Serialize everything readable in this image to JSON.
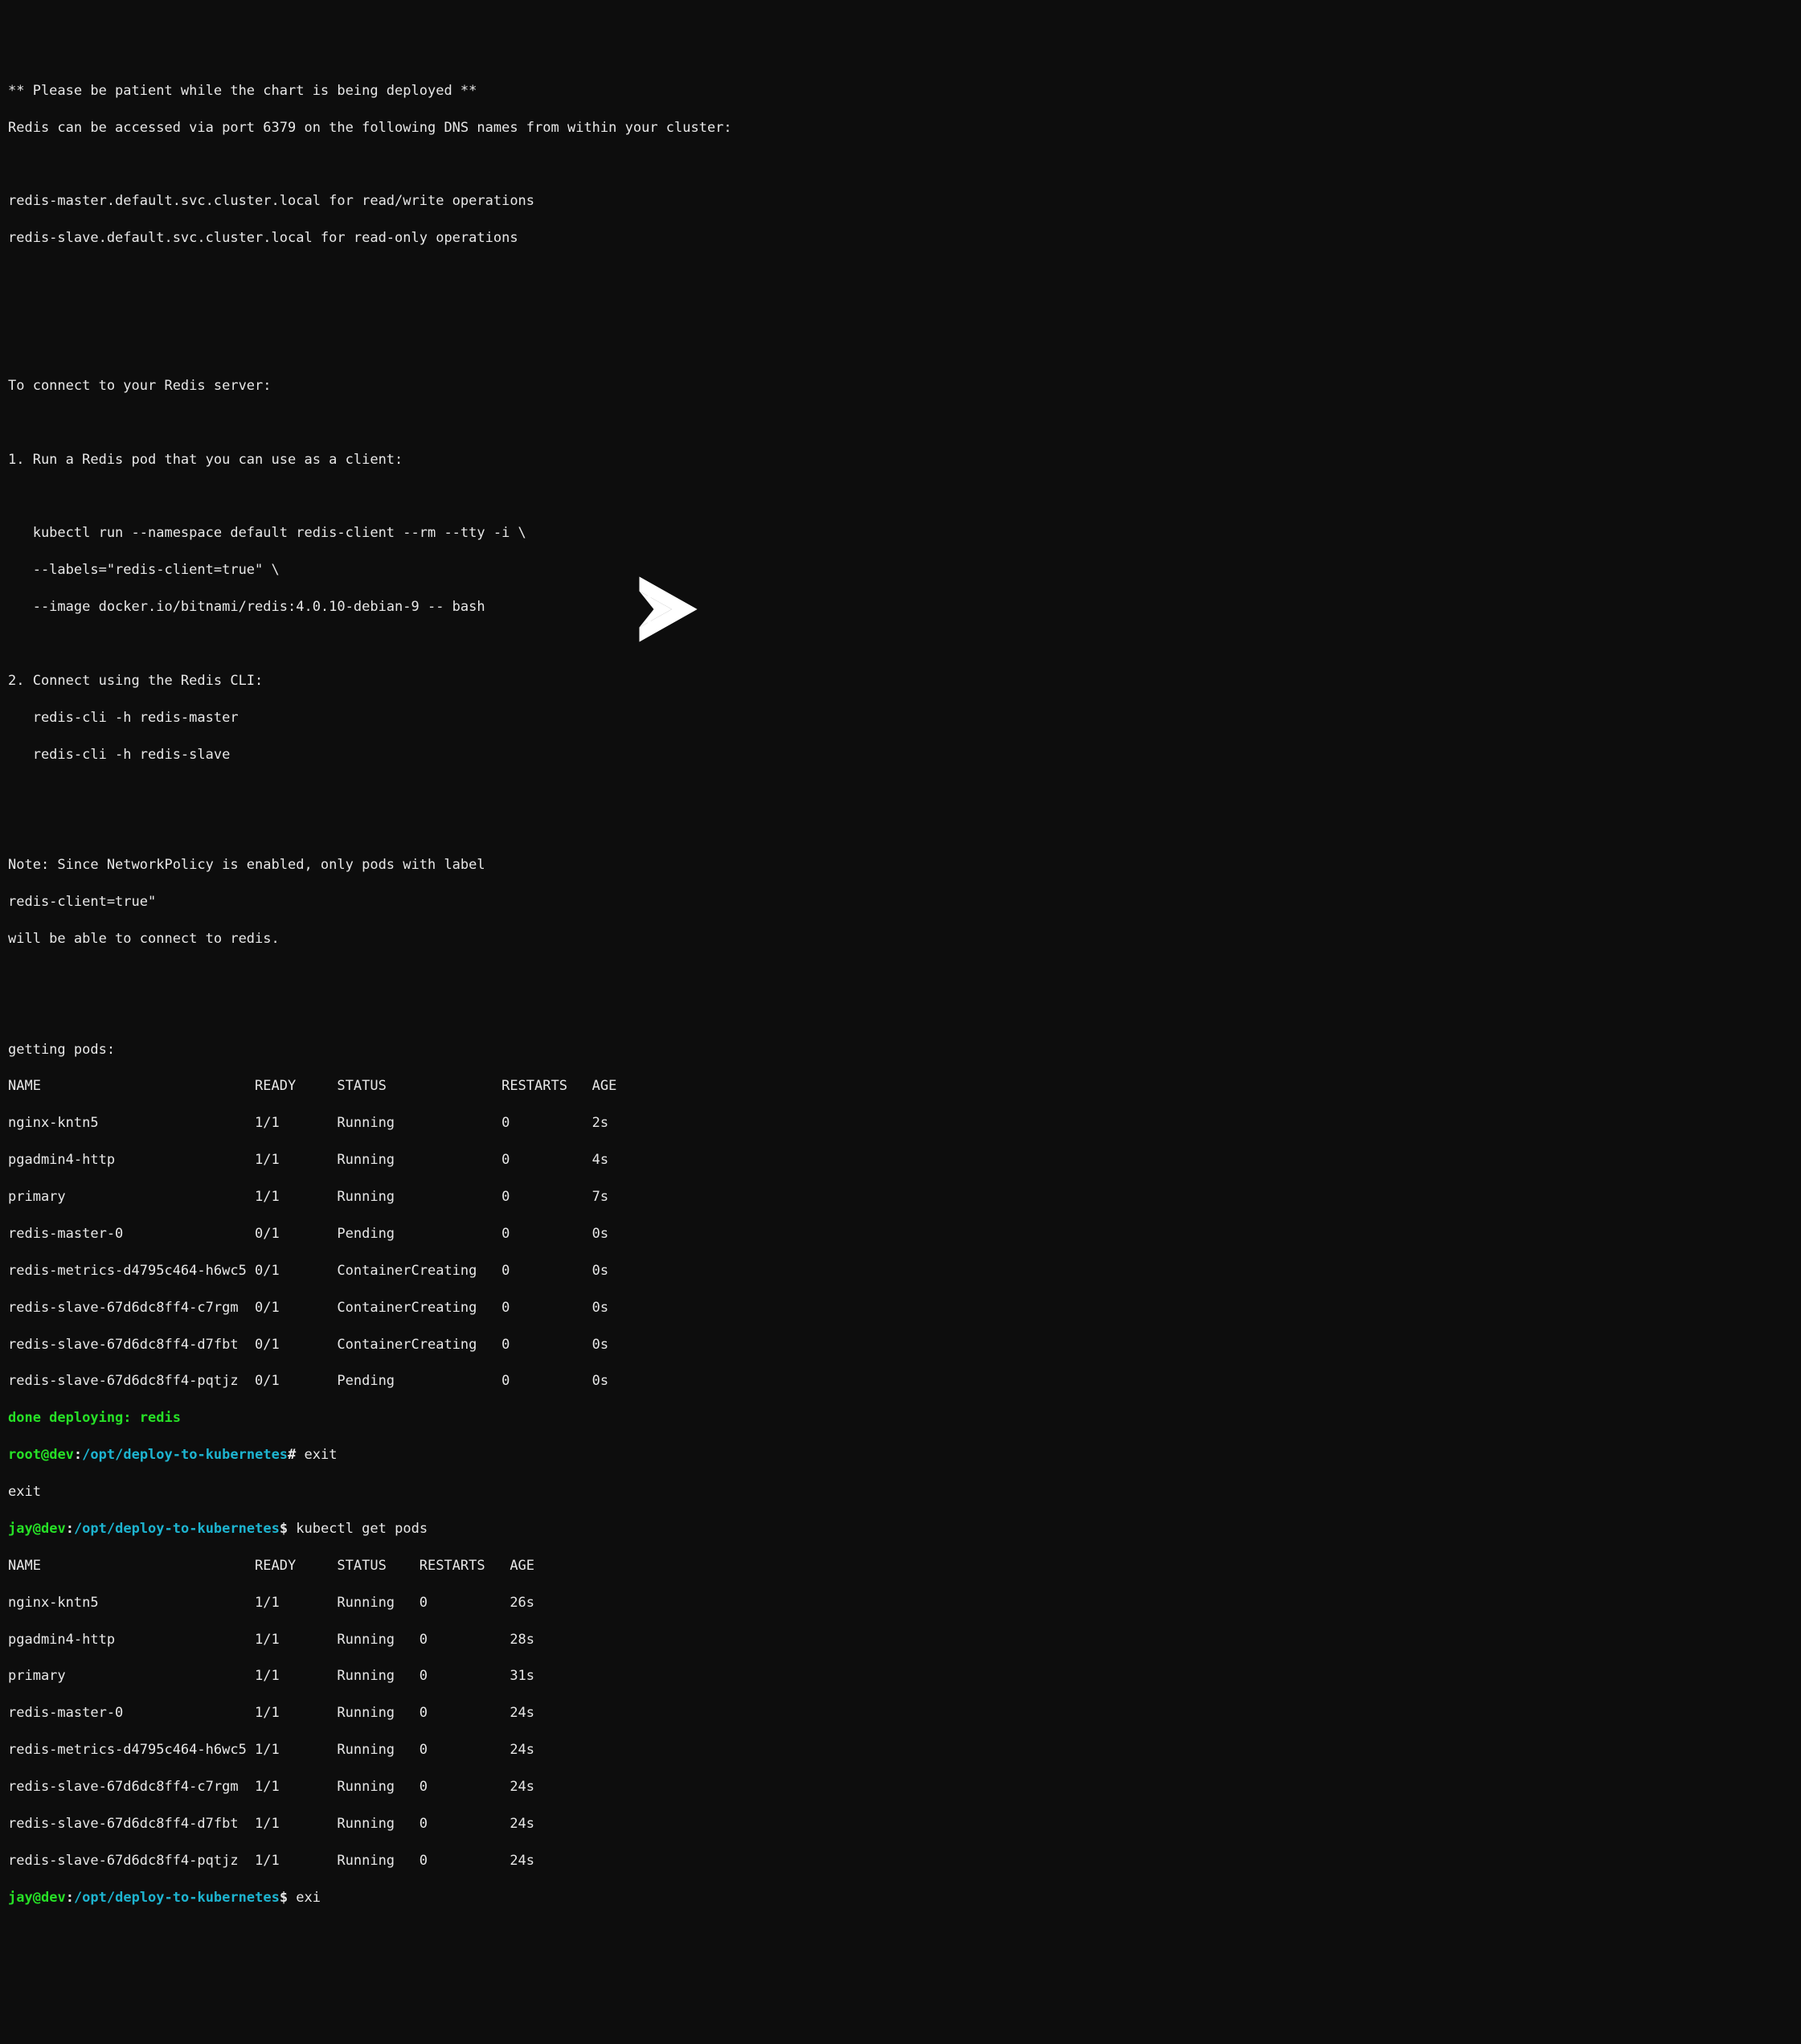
{
  "intro": {
    "line1": "** Please be patient while the chart is being deployed **",
    "line2": "Redis can be accessed via port 6379 on the following DNS names from within your cluster:",
    "blank1": "",
    "line3": "redis-master.default.svc.cluster.local for read/write operations",
    "line4": "redis-slave.default.svc.cluster.local for read-only operations",
    "blank2": "",
    "blank3": "",
    "blank4": "",
    "line5": "To connect to your Redis server:",
    "blank5": "",
    "line6": "1. Run a Redis pod that you can use as a client:",
    "blank6": "",
    "line7": "   kubectl run --namespace default redis-client --rm --tty -i \\",
    "line8": "   --labels=\"redis-client=true\" \\",
    "line9": "   --image docker.io/bitnami/redis:4.0.10-debian-9 -- bash",
    "blank7": "",
    "line10": "2. Connect using the Redis CLI:",
    "line11": "   redis-cli -h redis-master",
    "line12": "   redis-cli -h redis-slave",
    "blank8": "",
    "blank9": "",
    "line13": "Note: Since NetworkPolicy is enabled, only pods with label",
    "line14": "redis-client=true\"",
    "line15": "will be able to connect to redis.",
    "blank10": "",
    "blank11": ""
  },
  "pods1": {
    "header": "getting pods:",
    "cols": "NAME                          READY     STATUS              RESTARTS   AGE",
    "r1": "nginx-kntn5                   1/1       Running             0          2s",
    "r2": "pgadmin4-http                 1/1       Running             0          4s",
    "r3": "primary                       1/1       Running             0          7s",
    "r4": "redis-master-0                0/1       Pending             0          0s",
    "r5": "redis-metrics-d4795c464-h6wc5 0/1       ContainerCreating   0          0s",
    "r6": "redis-slave-67d6dc8ff4-c7rgm  0/1       ContainerCreating   0          0s",
    "r7": "redis-slave-67d6dc8ff4-d7fbt  0/1       ContainerCreating   0          0s",
    "r8": "redis-slave-67d6dc8ff4-pqtjz  0/1       Pending             0          0s"
  },
  "done_line": "done deploying: redis",
  "prompt1": {
    "user": "root",
    "at": "@",
    "host": "dev",
    "colon": ":",
    "path": "/opt/deploy-to-kubernetes",
    "hash": "#",
    "cmd": " exit"
  },
  "exit_echo": "exit",
  "prompt2": {
    "user": "jay",
    "at": "@",
    "host": "dev",
    "colon": ":",
    "path": "/opt/deploy-to-kubernetes",
    "dollar": "$",
    "cmd": " kubectl get pods"
  },
  "pods2": {
    "cols": "NAME                          READY     STATUS    RESTARTS   AGE",
    "r1": "nginx-kntn5                   1/1       Running   0          26s",
    "r2": "pgadmin4-http                 1/1       Running   0          28s",
    "r3": "primary                       1/1       Running   0          31s",
    "r4": "redis-master-0                1/1       Running   0          24s",
    "r5": "redis-metrics-d4795c464-h6wc5 1/1       Running   0          24s",
    "r6": "redis-slave-67d6dc8ff4-c7rgm  1/1       Running   0          24s",
    "r7": "redis-slave-67d6dc8ff4-d7fbt  1/1       Running   0          24s",
    "r8": "redis-slave-67d6dc8ff4-pqtjz  1/1       Running   0          24s"
  },
  "prompt3": {
    "user": "jay",
    "at": "@",
    "host": "dev",
    "colon": ":",
    "path": "/opt/deploy-to-kubernetes",
    "dollar": "$",
    "cmd": " exi"
  }
}
